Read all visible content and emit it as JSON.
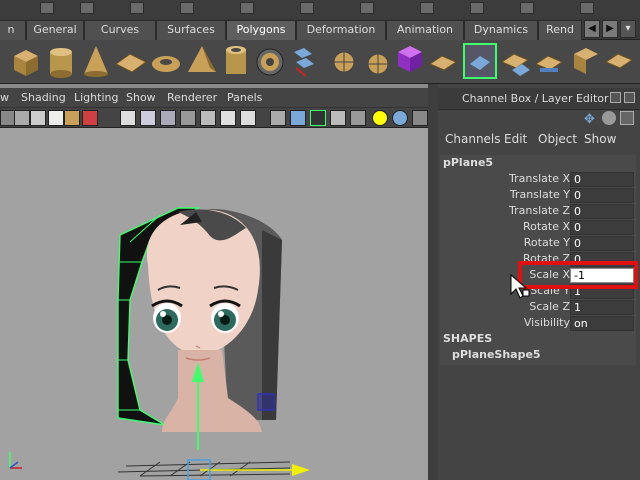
{
  "shelf_tabs": [
    {
      "label": "n"
    },
    {
      "label": "General"
    },
    {
      "label": "Curves"
    },
    {
      "label": "Surfaces"
    },
    {
      "label": "Polygons",
      "active": true
    },
    {
      "label": "Deformation"
    },
    {
      "label": "Animation"
    },
    {
      "label": "Dynamics"
    },
    {
      "label": "Rend"
    }
  ],
  "viewport_menu": [
    "w",
    "Shading",
    "Lighting",
    "Show",
    "Renderer",
    "Panels"
  ],
  "channel_box": {
    "title": "Channel Box / Layer Editor",
    "menu": [
      "Channels",
      "Edit",
      "Object",
      "Show"
    ],
    "node_name": "pPlane5",
    "attributes": [
      {
        "label": "Translate X",
        "value": "0"
      },
      {
        "label": "Translate Y",
        "value": "0"
      },
      {
        "label": "Translate Z",
        "value": "0"
      },
      {
        "label": "Rotate X",
        "value": "0"
      },
      {
        "label": "Rotate Y",
        "value": "0"
      },
      {
        "label": "Rotate Z",
        "value": "0"
      },
      {
        "label": "Scale X",
        "value": "-1"
      },
      {
        "label": "Scale Y",
        "value": "1"
      },
      {
        "label": "Scale Z",
        "value": "1"
      },
      {
        "label": "Visibility",
        "value": "on"
      }
    ],
    "shapes_header": "SHAPES",
    "shape_name": "pPlaneShape5"
  },
  "colors": {
    "highlight": "#e01010",
    "selection_green": "#3dff6e",
    "viewport_bg": "#a2a2a2"
  }
}
